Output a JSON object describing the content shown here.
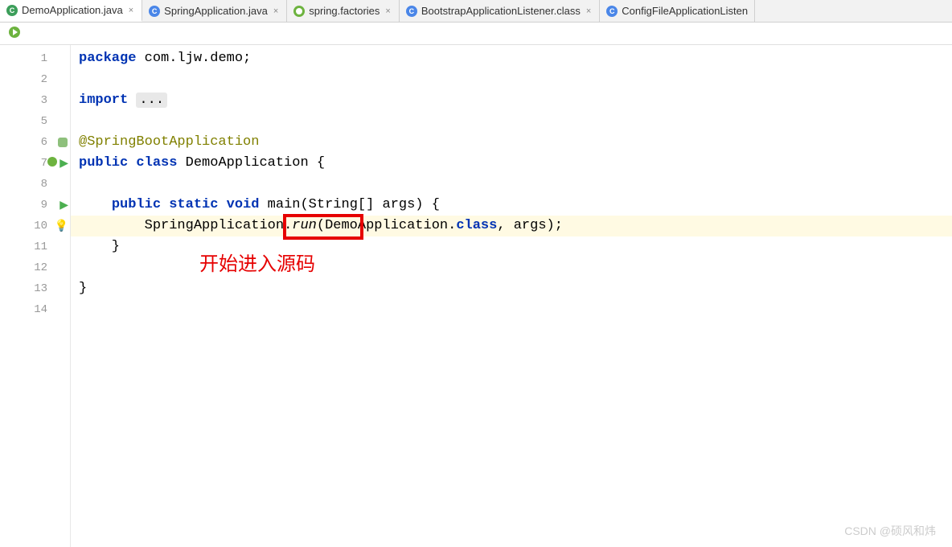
{
  "tabs": [
    {
      "label": "DemoApplication.java",
      "icon": "icon-c green",
      "active": true
    },
    {
      "label": "SpringApplication.java",
      "icon": "icon-c",
      "active": false
    },
    {
      "label": "spring.factories",
      "icon": "icon-spring",
      "active": false
    },
    {
      "label": "BootstrapApplicationListener.class",
      "icon": "icon-c",
      "active": false
    },
    {
      "label": "ConfigFileApplicationListen",
      "icon": "icon-c",
      "active": false
    }
  ],
  "gutter": {
    "lines": [
      "1",
      "2",
      "3",
      "5",
      "6",
      "7",
      "8",
      "9",
      "10",
      "11",
      "12",
      "13",
      "14"
    ]
  },
  "code": {
    "package_kw": "package",
    "package_name": " com.ljw.demo;",
    "import_kw": "import ",
    "import_fold": "...",
    "annotation": "@SpringBootApplication",
    "public_kw": "public ",
    "class_kw": "class ",
    "class_name": "DemoApplication {",
    "static_kw": "static ",
    "void_kw": "void ",
    "main_sig": "main(String[] args) {",
    "spring_app": "SpringApplication",
    "dot": ".",
    "run": "run",
    "run_args_pre": "(Demo",
    "run_args_mid": "Application.",
    "class_ref": "class",
    "run_args_post": ", args);",
    "close_brace1": "    }",
    "close_brace2": "}"
  },
  "annotation_label": "开始进入源码",
  "watermark": "CSDN @硕风和炜"
}
